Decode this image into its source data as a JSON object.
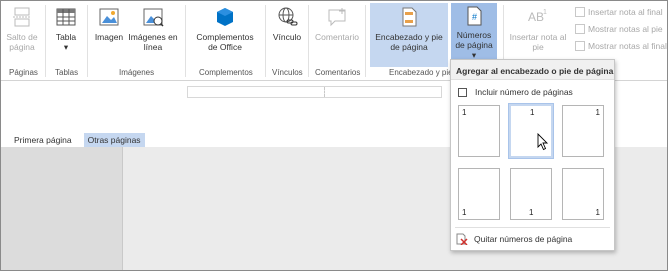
{
  "ribbon": {
    "groups": [
      {
        "label": "Páginas"
      },
      {
        "label": "Tablas"
      },
      {
        "label": "Imágenes"
      },
      {
        "label": "Complementos"
      },
      {
        "label": "Vínculos"
      },
      {
        "label": "Comentarios"
      },
      {
        "label": "Encabezado y pie de"
      }
    ],
    "buttons": {
      "page_break": "Salto de página",
      "table": "Tabla",
      "table_arrow": "▾",
      "image": "Imagen",
      "online_images": "Imágenes en línea",
      "office_addins": "Complementos de Office",
      "link": "Vínculo",
      "comment": "Comentario",
      "header_footer": "Encabezado y pie de página",
      "page_numbers": "Números de página",
      "page_numbers_arrow": "▾",
      "footnote": "Insertar nota al pie",
      "endnote": "Insertar nota al final",
      "next_footnote": "Mostrar notas al pie",
      "show_endnotes": "Mostrar notas al final"
    }
  },
  "document": {
    "tabs": [
      "Primera página",
      "Otras páginas"
    ],
    "active_tab": "Otras páginas"
  },
  "dropdown": {
    "title": "Agregar al encabezado o pie de página",
    "include_label": "Incluir número de páginas",
    "include_checked": false,
    "thumbnails": [
      {
        "position": "top-left",
        "number": "1"
      },
      {
        "position": "top-center",
        "number": "1"
      },
      {
        "position": "top-right",
        "number": "1"
      },
      {
        "position": "bottom-left",
        "number": "1"
      },
      {
        "position": "bottom-center",
        "number": "1"
      },
      {
        "position": "bottom-right",
        "number": "1"
      }
    ],
    "remove_label": "Quitar números de página"
  },
  "colors": {
    "accent": "#0072c6",
    "selected": "#c5d7f0",
    "disabled": "#a8a8a8"
  }
}
